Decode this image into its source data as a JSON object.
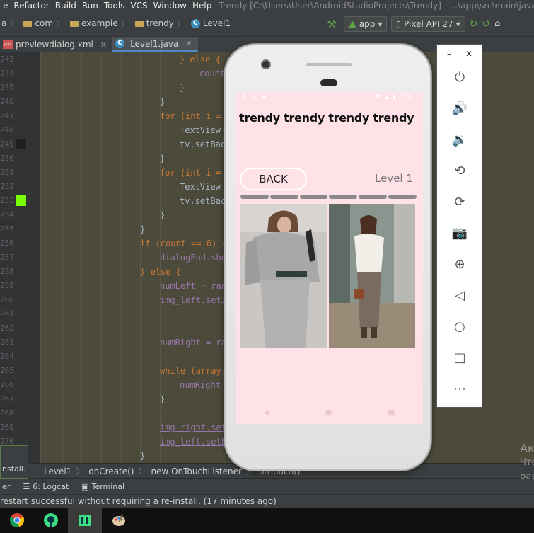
{
  "menu": {
    "items": [
      "e",
      "Refactor",
      "Build",
      "Run",
      "Tools",
      "VCS",
      "Window",
      "Help"
    ],
    "window_title": "Trendy [C:\\Users\\User\\AndroidStudioProjects\\Trendy] - ...\\app\\src\\main\\java\\com\\"
  },
  "breadcrumbs": [
    "a",
    "com",
    "example",
    "trendy",
    "Level1"
  ],
  "run_config": "app",
  "device": "Pixel API 27",
  "tabs": [
    {
      "label": "previewdialog.xml",
      "type": "xml",
      "active": false
    },
    {
      "label": "Level1.java",
      "type": "java",
      "active": true
    }
  ],
  "editor": {
    "line_numbers": [
      "243",
      "244",
      "245",
      "246",
      "247",
      "248",
      "249",
      "250",
      "251",
      "252",
      "253",
      "254",
      "255",
      "256",
      "257",
      "258",
      "259",
      "260",
      "261",
      "262",
      "263",
      "264",
      "265",
      "266",
      "267",
      "268",
      "269",
      "270",
      "271"
    ],
    "lines": [
      {
        "t": "} else {",
        "c": "brace"
      },
      {
        "t": "count",
        "c": "field"
      },
      {
        "t": "}",
        "c": "plain"
      },
      {
        "t": "}",
        "c": "plain"
      },
      {
        "t": "for (int i =",
        "c": "for"
      },
      {
        "t": "TextView",
        "c": "plain"
      },
      {
        "t": "tv.setBac",
        "c": "plain"
      },
      {
        "t": "}",
        "c": "plain"
      },
      {
        "t": "for (int i =",
        "c": "for"
      },
      {
        "t": "TextView",
        "c": "plain"
      },
      {
        "t": "tv.setBac",
        "c": "plain"
      },
      {
        "t": "}",
        "c": "plain"
      },
      {
        "t": "}",
        "c": "plain"
      },
      {
        "t": "if (count == 6) {",
        "c": "if"
      },
      {
        "t": "dialogEnd.sho",
        "c": "field"
      },
      {
        "t": "} else {",
        "c": "brace"
      },
      {
        "t": "numLeft = ran",
        "c": "field"
      },
      {
        "t": "img_left.setI",
        "c": "ul"
      },
      {
        "t": "",
        "c": "plain"
      },
      {
        "t": "",
        "c": "plain"
      },
      {
        "t": "numRight = ra",
        "c": "field"
      },
      {
        "t": "",
        "c": "plain"
      },
      {
        "t": "while (array.",
        "c": "while"
      },
      {
        "t": "numRight",
        "c": "field"
      },
      {
        "t": "}",
        "c": "plain"
      },
      {
        "t": "",
        "c": "plain"
      },
      {
        "t": "img_right.set",
        "c": "ul"
      },
      {
        "t": "img_left.setE",
        "c": "ul"
      },
      {
        "t": "}",
        "c": "plain"
      }
    ]
  },
  "code_crumbs": [
    "Level1",
    "onCreate()",
    "new OnTouchListener",
    "onTouch()"
  ],
  "install_popup": "nstall.",
  "tool_windows": [
    "ler",
    "6: Logcat",
    "Terminal"
  ],
  "status_message": "restart successful without requiring a re-install. (17 minutes ago)",
  "activate_watermark": {
    "line1": "Ак",
    "line2": "Что",
    "line3": "раз"
  },
  "app": {
    "status_time": "7:02",
    "title": "trendy trendy trendy trendy",
    "back_label": "BACK",
    "level_label": "Level 1",
    "progress_segments": 6,
    "background_color": "#ffe1e8"
  },
  "emulator_controls": [
    "power-icon",
    "volume-up-icon",
    "volume-down-icon",
    "rotate-left-icon",
    "rotate-right-icon",
    "camera-icon",
    "zoom-icon",
    "back-icon",
    "home-icon",
    "overview-icon",
    "more-icon"
  ]
}
